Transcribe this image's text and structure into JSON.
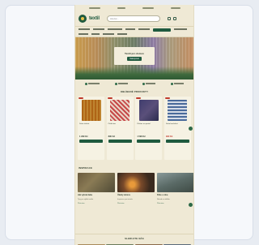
{
  "header": {
    "logo_text": "textil",
    "search_placeholder": "Hledat..."
  },
  "hero": {
    "title": "Textil pro domov",
    "button": "Nakupovat"
  },
  "sections": {
    "products_title": "OBLÍBENÉ PRODUKTY",
    "blog_title": "INSPIRACE",
    "footer_title": "SLEDUJTE NÁS"
  },
  "products": [
    {
      "name": "Deka vlněná",
      "price": "1 290 Kč"
    },
    {
      "name": "Pléd káro",
      "price": "890 Kč"
    },
    {
      "name": "Přehoz na postel",
      "price": "1 590 Kč"
    },
    {
      "name": "Deka bavlněná",
      "price": "990 Kč"
    }
  ],
  "blog": [
    {
      "title": "Jak vybrat deku",
      "text": "Tipy pro výběr textilu",
      "link": "Číst více"
    },
    {
      "title": "Útulný domov",
      "text": "Inspirace pro interiér",
      "link": "Číst více"
    },
    {
      "title": "Péče o vlnu",
      "text": "Návod na údržbu",
      "link": "Číst více"
    }
  ],
  "colors": {
    "brand_green": "#1f5a3f",
    "page_bg": "#efe9d5",
    "sale_red": "#c0392b"
  }
}
